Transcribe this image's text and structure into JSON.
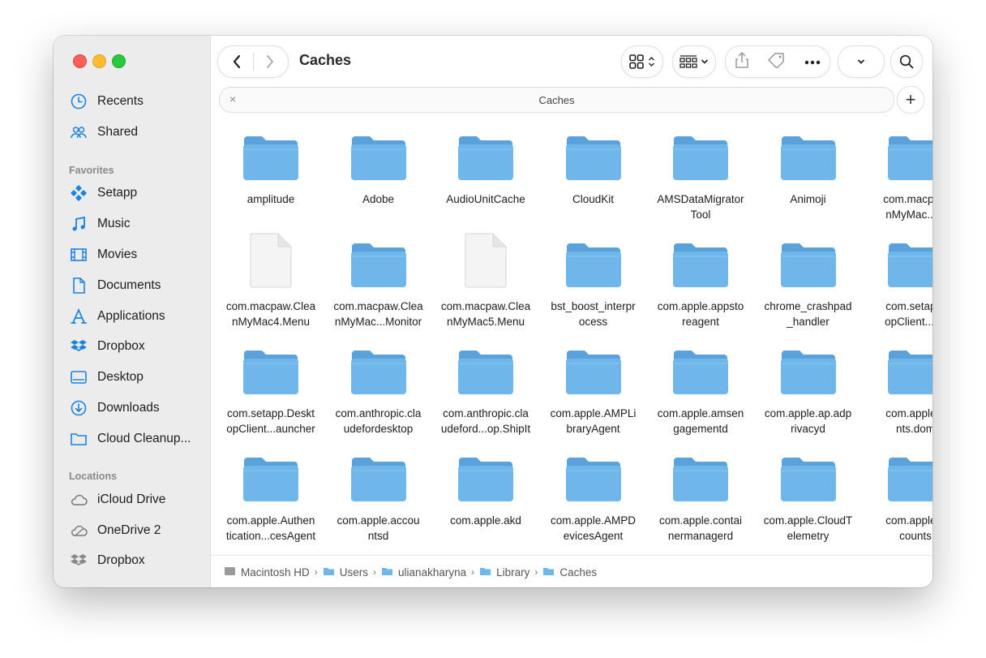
{
  "window": {
    "title": "Caches"
  },
  "sidebar": {
    "top_items": [
      {
        "label": "Recents",
        "icon": "clock-icon"
      },
      {
        "label": "Shared",
        "icon": "people-icon"
      }
    ],
    "favorites_header": "Favorites",
    "favorites": [
      {
        "label": "Setapp",
        "icon": "setapp-icon"
      },
      {
        "label": "Music",
        "icon": "music-note-icon"
      },
      {
        "label": "Movies",
        "icon": "film-icon"
      },
      {
        "label": "Documents",
        "icon": "document-icon"
      },
      {
        "label": "Applications",
        "icon": "applications-icon"
      },
      {
        "label": "Dropbox",
        "icon": "dropbox-icon"
      },
      {
        "label": "Desktop",
        "icon": "desktop-icon"
      },
      {
        "label": "Downloads",
        "icon": "download-icon"
      },
      {
        "label": "Cloud Cleanup...",
        "icon": "folder-icon"
      }
    ],
    "locations_header": "Locations",
    "locations": [
      {
        "label": "iCloud Drive",
        "icon": "cloud-icon"
      },
      {
        "label": "OneDrive 2",
        "icon": "onedrive-icon"
      },
      {
        "label": "Dropbox",
        "icon": "dropbox-icon"
      }
    ]
  },
  "search": {
    "label": "Caches",
    "clear": "×",
    "add": "+"
  },
  "items": [
    {
      "name": "amplitude",
      "kind": "folder"
    },
    {
      "name": "Adobe",
      "kind": "folder"
    },
    {
      "name": "AudioUnitCache",
      "kind": "folder"
    },
    {
      "name": "CloudKit",
      "kind": "folder"
    },
    {
      "name": "AMSDataMigratorTool",
      "kind": "folder"
    },
    {
      "name": "Animoji",
      "kind": "folder"
    },
    {
      "name": "com.macpaw.CleanMyMac...M",
      "kind": "folder"
    },
    {
      "name": "com.macpaw.CleanMyMac4.Menu",
      "kind": "file"
    },
    {
      "name": "com.macpaw.CleanMyMac...Monitor",
      "kind": "folder"
    },
    {
      "name": "com.macpaw.CleanMyMac5.Menu",
      "kind": "file"
    },
    {
      "name": "bst_boost_interprocess",
      "kind": "folder"
    },
    {
      "name": "com.apple.appstoreagent",
      "kind": "folder"
    },
    {
      "name": "chrome_crashpad_handler",
      "kind": "folder"
    },
    {
      "name": "com.setapp.DesktopClient...pp",
      "kind": "folder"
    },
    {
      "name": "com.setapp.DesktopClient...auncher",
      "kind": "folder"
    },
    {
      "name": "com.anthropic.claudefordesktop",
      "kind": "folder"
    },
    {
      "name": "com.anthropic.claudeford...op.ShipIt",
      "kind": "folder"
    },
    {
      "name": "com.apple.AMPLibraryAgent",
      "kind": "folder"
    },
    {
      "name": "com.apple.amsengagementd",
      "kind": "folder"
    },
    {
      "name": "com.apple.ap.adprivacyd",
      "kind": "folder"
    },
    {
      "name": "com.apple.ants.dom",
      "kind": "folder"
    },
    {
      "name": "com.apple.Authentication...cesAgent",
      "kind": "folder"
    },
    {
      "name": "com.apple.accountsd",
      "kind": "folder"
    },
    {
      "name": "com.apple.akd",
      "kind": "folder"
    },
    {
      "name": "com.apple.AMPDevicesAgent",
      "kind": "folder"
    },
    {
      "name": "com.apple.containermanagerd",
      "kind": "folder"
    },
    {
      "name": "com.apple.CloudTelemetry",
      "kind": "folder"
    },
    {
      "name": "com.apple.accounts",
      "kind": "folder"
    }
  ],
  "item_lines": [
    [
      "amplitude"
    ],
    [
      "Adobe"
    ],
    [
      "AudioUnitCache"
    ],
    [
      "CloudKit"
    ],
    [
      "AMSDataMigrator",
      "Tool"
    ],
    [
      "Animoji"
    ],
    [
      "com.macpaw",
      "nMyMac...M"
    ],
    [
      "com.macpaw.Clea",
      "nMyMac4.Menu"
    ],
    [
      "com.macpaw.Clea",
      "nMyMac...Monitor"
    ],
    [
      "com.macpaw.Clea",
      "nMyMac5.Menu"
    ],
    [
      "bst_boost_interpr",
      "ocess"
    ],
    [
      "com.apple.appsto",
      "reagent"
    ],
    [
      "chrome_crashpad",
      "_handler"
    ],
    [
      "com.setapp.",
      "opClient...pp"
    ],
    [
      "com.setapp.Deskt",
      "opClient...auncher"
    ],
    [
      "com.anthropic.cla",
      "udefordesktop"
    ],
    [
      "com.anthropic.cla",
      "udeford...op.ShipIt"
    ],
    [
      "com.apple.AMPLi",
      "braryAgent"
    ],
    [
      "com.apple.amsen",
      "gagementd"
    ],
    [
      "com.apple.ap.adp",
      "rivacyd"
    ],
    [
      "com.apple.a",
      "nts.dom"
    ],
    [
      "com.apple.Authen",
      "tication...cesAgent"
    ],
    [
      "com.apple.accou",
      "ntsd"
    ],
    [
      "com.apple.akd"
    ],
    [
      "com.apple.AMPD",
      "evicesAgent"
    ],
    [
      "com.apple.contai",
      "nermanagerd"
    ],
    [
      "com.apple.CloudT",
      "elemetry"
    ],
    [
      "com.apple.a",
      "counts"
    ]
  ],
  "pathbar": [
    "Macintosh HD",
    "Users",
    "ulianakharyna",
    "Library",
    "Caches"
  ],
  "colors": {
    "folder": "#6fb6ea",
    "folder_dark": "#5aa2dc",
    "accent": "#1a82e2",
    "sidebar_icon": "#1a82e2"
  }
}
